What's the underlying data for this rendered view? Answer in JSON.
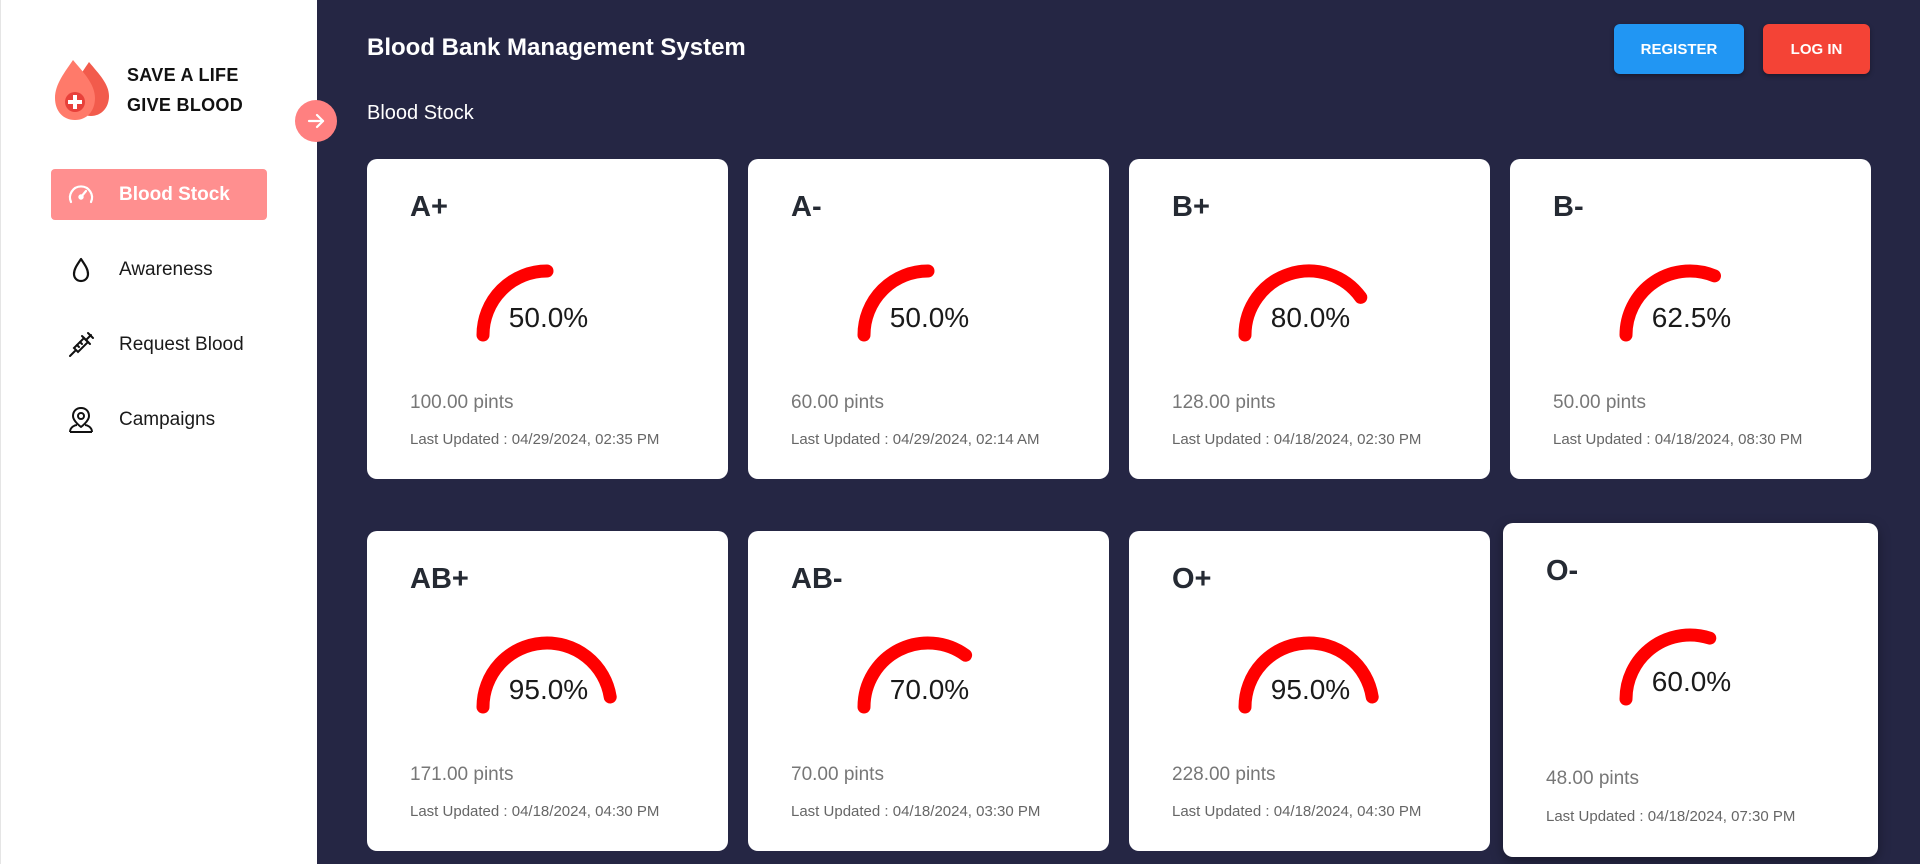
{
  "brand": {
    "line1": "SAVE A LIFE",
    "line2": "GIVE BLOOD",
    "logo_icon": "blood-drops-icon"
  },
  "sidebar": {
    "items": [
      {
        "label": "Blood Stock",
        "icon": "speedometer-icon",
        "active": true
      },
      {
        "label": "Awareness",
        "icon": "drop-icon",
        "active": false
      },
      {
        "label": "Request Blood",
        "icon": "syringe-icon",
        "active": false
      },
      {
        "label": "Campaigns",
        "icon": "location-person-icon",
        "active": false
      }
    ],
    "collapse_icon": "arrow-right-icon"
  },
  "header": {
    "title": "Blood Bank Management System",
    "section": "Blood Stock",
    "register_label": "REGISTER",
    "login_label": "LOG IN"
  },
  "colors": {
    "main_bg": "#252644",
    "accent_red": "#ff0000",
    "active_nav": "#ff8f8f",
    "register": "#2196f3",
    "login": "#f44336"
  },
  "cards": [
    {
      "group": "A+",
      "percent": 50.0,
      "percent_text": "50.0%",
      "pints": "100.00 pints",
      "updated": "Last Updated : 04/29/2024, 02:35 PM"
    },
    {
      "group": "A-",
      "percent": 50.0,
      "percent_text": "50.0%",
      "pints": "60.00 pints",
      "updated": "Last Updated : 04/29/2024, 02:14 AM"
    },
    {
      "group": "B+",
      "percent": 80.0,
      "percent_text": "80.0%",
      "pints": "128.00 pints",
      "updated": "Last Updated : 04/18/2024, 02:30 PM"
    },
    {
      "group": "B-",
      "percent": 62.5,
      "percent_text": "62.5%",
      "pints": "50.00 pints",
      "updated": "Last Updated : 04/18/2024, 08:30 PM"
    },
    {
      "group": "AB+",
      "percent": 95.0,
      "percent_text": "95.0%",
      "pints": "171.00 pints",
      "updated": "Last Updated : 04/18/2024, 04:30 PM"
    },
    {
      "group": "AB-",
      "percent": 70.0,
      "percent_text": "70.0%",
      "pints": "70.00 pints",
      "updated": "Last Updated : 04/18/2024, 03:30 PM"
    },
    {
      "group": "O+",
      "percent": 95.0,
      "percent_text": "95.0%",
      "pints": "228.00 pints",
      "updated": "Last Updated : 04/18/2024, 04:30 PM"
    },
    {
      "group": "O-",
      "percent": 60.0,
      "percent_text": "60.0%",
      "pints": "48.00 pints",
      "updated": "Last Updated : 04/18/2024, 07:30 PM"
    }
  ]
}
